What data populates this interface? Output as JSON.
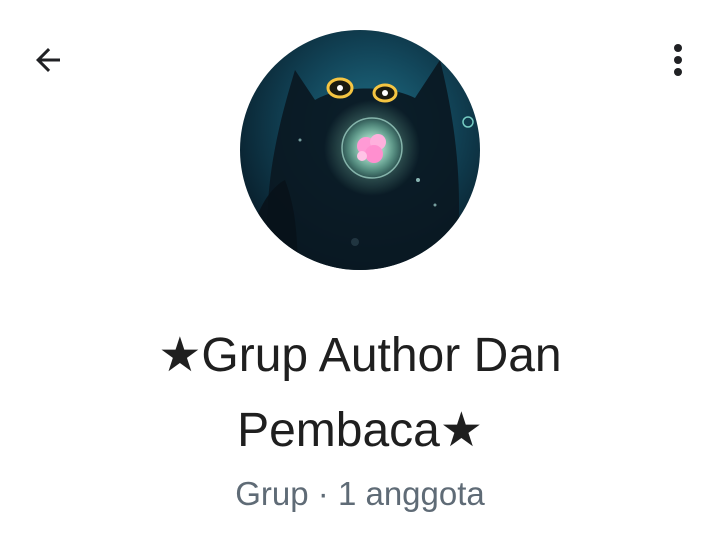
{
  "header": {
    "back_icon": "arrow-left-icon",
    "menu_icon": "more-vert-icon"
  },
  "group": {
    "avatar_description": "group-avatar",
    "name": "★Grup Author Dan Pembaca★",
    "type": "Grup",
    "separator": "·",
    "members": "1 anggota"
  },
  "colors": {
    "background": "#ffffff",
    "title_text": "#1f1f1f",
    "subtitle_text": "#5f6b76",
    "icon": "#202124"
  }
}
